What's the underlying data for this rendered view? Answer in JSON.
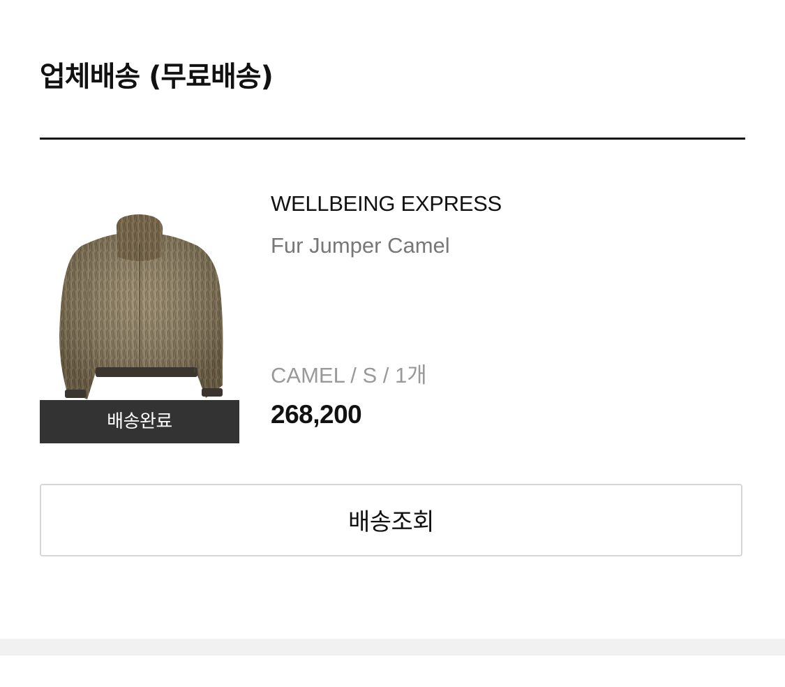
{
  "section": {
    "title": "업체배송 (무료배송)"
  },
  "order_item": {
    "image": {
      "alt": "fur-jumper-camel-photo",
      "icon": "product-photo"
    },
    "status_label": "배송완료",
    "brand": "WELLBEING EXPRESS",
    "product_name": "Fur Jumper Camel",
    "option": "CAMEL / S / 1개",
    "price": "268,200"
  },
  "actions": {
    "track_label": "배송조회"
  },
  "colors": {
    "text_primary": "#111111",
    "text_secondary": "#777777",
    "text_tertiary": "#999999",
    "status_overlay_bg": "#333333",
    "button_border": "#d6d6d6",
    "divider_bg": "#f1f1f1",
    "fur_main": "#8a7a5a"
  }
}
